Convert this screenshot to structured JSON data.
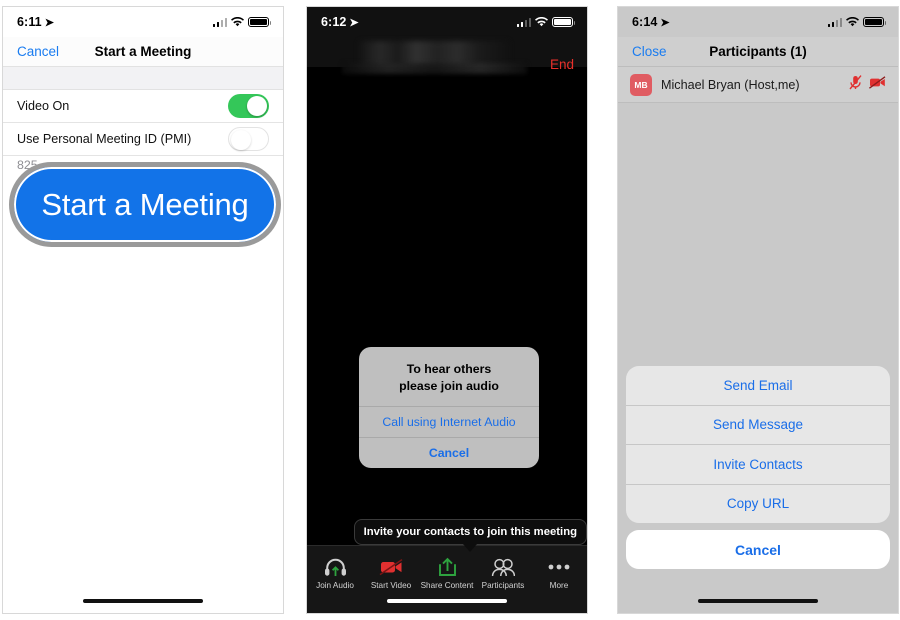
{
  "panels": [
    {
      "id": "start-a-meeting",
      "statusbar": {
        "time": "6:11",
        "location_arrow": "location-arrow-icon",
        "signal": "signal-bars-icon",
        "wifi": "wifi-icon",
        "battery": "battery-icon"
      },
      "navbar": {
        "left_button": "Cancel",
        "title": "Start a Meeting"
      },
      "rows": [
        {
          "label": "Video On",
          "toggle": "on"
        },
        {
          "label": "Use Personal Meeting ID (PMI)",
          "toggle": "off",
          "subtitle": "825"
        }
      ],
      "callout_button": "Start a Meeting"
    },
    {
      "id": "in-meeting",
      "statusbar": {
        "time": "6:12",
        "location_arrow": "location-arrow-icon",
        "signal": "signal-bars-icon",
        "wifi": "wifi-icon",
        "battery": "battery-icon"
      },
      "navbar": {
        "title_redacted": "",
        "right_button": "End"
      },
      "dialog": {
        "message_line1": "To hear others",
        "message_line2": "please join audio",
        "primary": "Call using Internet Audio",
        "cancel": "Cancel"
      },
      "tooltip": "Invite your contacts to join this meeting",
      "toolbar": [
        {
          "label": "Join Audio",
          "icon": "headphones-icon"
        },
        {
          "label": "Start Video",
          "icon": "video-off-icon"
        },
        {
          "label": "Share Content",
          "icon": "share-up-icon"
        },
        {
          "label": "Participants",
          "icon": "people-icon"
        },
        {
          "label": "More",
          "icon": "ellipsis-icon"
        }
      ]
    },
    {
      "id": "participants",
      "statusbar": {
        "time": "6:14",
        "location_arrow": "location-arrow-icon",
        "signal": "signal-bars-icon",
        "wifi": "wifi-icon",
        "battery": "battery-icon"
      },
      "navbar": {
        "left_button": "Close",
        "title": "Participants (1)"
      },
      "participant": {
        "initials": "MB",
        "name": "Michael Bryan (Host,me)",
        "mic": "mic-muted-icon",
        "video": "video-off-icon"
      },
      "action_sheet": {
        "items": [
          "Send Email",
          "Send Message",
          "Invite Contacts",
          "Copy URL"
        ],
        "cancel": "Cancel"
      }
    }
  ],
  "colors": {
    "ios_blue": "#1a6ee8",
    "zoom_blue": "#1273e8",
    "toggle_green": "#34c759",
    "red_end": "#e8302a",
    "avatar_red": "#e05c62",
    "share_green": "#2ea33f"
  }
}
